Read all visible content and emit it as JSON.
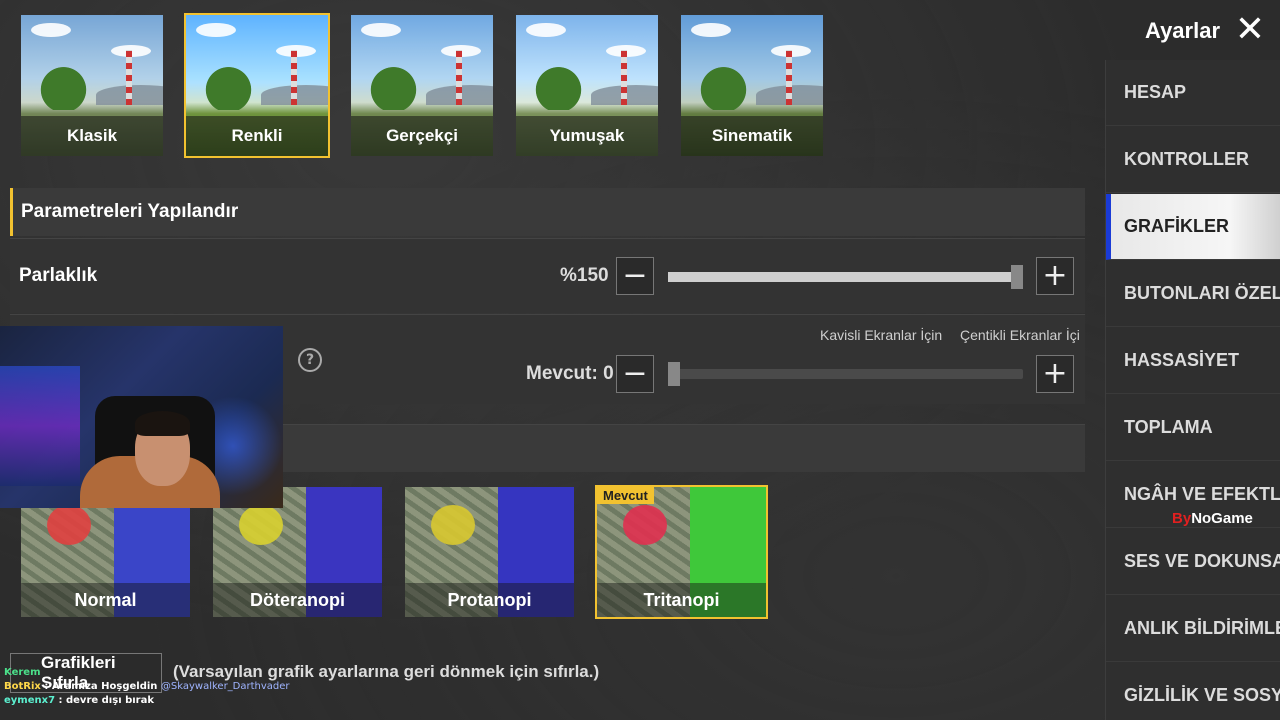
{
  "header": {
    "title": "Ayarlar",
    "close_icon": "close-icon"
  },
  "presets": [
    {
      "label": "Klasik",
      "selected": false
    },
    {
      "label": "Renkli",
      "selected": true
    },
    {
      "label": "Gerçekçi",
      "selected": false
    },
    {
      "label": "Yumuşak",
      "selected": false
    },
    {
      "label": "Sinematik",
      "selected": false
    }
  ],
  "params": {
    "section_title": "Parametreleri Yapılandır",
    "brightness": {
      "label": "Parlaklık",
      "value_text": "%150",
      "fill_fraction": 1.0
    },
    "second": {
      "value_text": "Mevcut: 0",
      "fill_fraction": 0.0,
      "hint_curved": "Kavisli Ekranlar İçin",
      "hint_notch": "Çentikli Ekranlar İçi"
    }
  },
  "colorblind_modes": [
    {
      "label": "Normal",
      "selected": false,
      "dot_color": "#e04040",
      "water_color": "#3a45c8"
    },
    {
      "label": "Döteranopi",
      "selected": false,
      "dot_color": "#d8d030",
      "water_color": "#3a35c0"
    },
    {
      "label": "Protanopi",
      "selected": false,
      "dot_color": "#d8c830",
      "water_color": "#3535c0"
    },
    {
      "label": "Tritanopi",
      "selected": true,
      "badge": "Mevcut",
      "dot_color": "#e03050",
      "water_color": "#3fc83a"
    }
  ],
  "reset": {
    "button_label": "Grafikleri Sıfırla",
    "note": "(Varsayılan grafik ayarlarına geri dönmek için sıfırla.)"
  },
  "sidebar": {
    "items": [
      {
        "label": "HESAP"
      },
      {
        "label": "KONTROLLER"
      },
      {
        "label": "GRAFİKLER",
        "active": true
      },
      {
        "label": "BUTONLARI ÖZELLEŞ"
      },
      {
        "label": "HASSASİYET"
      },
      {
        "label": "TOPLAMA"
      },
      {
        "label": "NGÂH VE EFEKTLER"
      },
      {
        "label": "SES VE DOKUNSAL"
      },
      {
        "label": "ANLIK BİLDİRİMLER"
      },
      {
        "label": "GİZLİLİK VE SOSYAL"
      }
    ]
  },
  "watermark": {
    "prefix": "By",
    "text": "NoGame"
  },
  "chat": [
    {
      "user": "Kerem",
      "message": ""
    },
    {
      "user": "BotRix",
      "message": ": Aramıza Hoşgeldin",
      "mention": "@Skaywalker_Darthvader"
    },
    {
      "user": "eymenx7",
      "message": ": devre dışı bırak"
    }
  ],
  "colors": {
    "accent": "#f2c230",
    "sidebar_active_bar": "#1a3bd6"
  }
}
